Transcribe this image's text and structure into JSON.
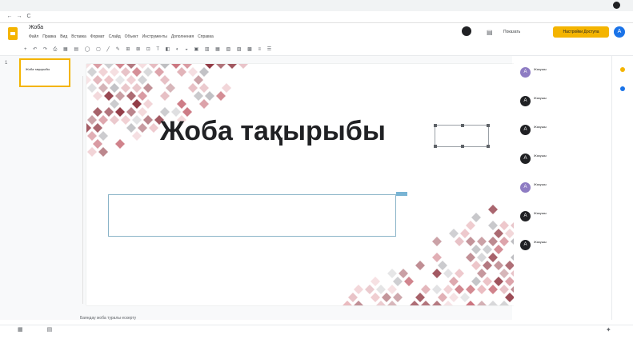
{
  "browser": {
    "url": "",
    "nav_back": "←",
    "nav_forward": "→",
    "nav_reload": "C"
  },
  "app": {
    "title": "Жоба",
    "menu": [
      "Файл",
      "Правка",
      "Вид",
      "Вставка",
      "Формат",
      "Слайд",
      "Объект",
      "Инструменты",
      "Дополнения",
      "Справка"
    ],
    "present_label": "Показать",
    "share_label": "Настройки Доступа",
    "user_initial": "A",
    "comments_glyph": "▤"
  },
  "toolbar": {
    "glyphs": "+ ↶ ↷ ⎙ ▦ ▤ ◯ ▢ ╱ ✎ ⊞ ⊠ ⊡ T ◧ ◐ ◒ ▣ ▥ ▦ ▧ ▨ ▩ ≡ ☰"
  },
  "filmstrip": {
    "slide_number": "1",
    "thumb_title": "Жоба тақырыбы"
  },
  "slide": {
    "title": "Жоба тақырыбы",
    "subtitle": ""
  },
  "comments": [
    {
      "initial": "A",
      "name": "Жазушы",
      "time": "",
      "text": ""
    },
    {
      "initial": "A",
      "name": "Жазушы",
      "time": "",
      "text": ""
    },
    {
      "initial": "A",
      "name": "Жазушы",
      "time": "",
      "text": ""
    },
    {
      "initial": "A",
      "name": "Жазушы",
      "time": "",
      "text": ""
    },
    {
      "initial": "A",
      "name": "Жазушы",
      "time": "",
      "text": ""
    },
    {
      "initial": "A",
      "name": "Жазушы",
      "time": "",
      "text": ""
    },
    {
      "initial": "A",
      "name": "Жазушы",
      "time": "",
      "text": ""
    }
  ],
  "notes": {
    "placeholder": "Баяндау жоба туралы ескерту"
  },
  "colors": {
    "accent": "#f4b400",
    "deco_dark": "#8b2f3a",
    "deco_mid": "#c76b76",
    "deco_light": "#e8b5ba",
    "deco_grey": "#b9b9bd"
  }
}
